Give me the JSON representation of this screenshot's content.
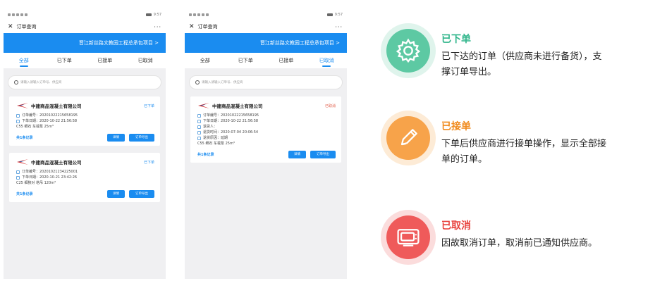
{
  "phones": [
    {
      "status_time": "9:57",
      "nav_title": "订单查询",
      "project": "晋江新丝路文教园工程总承包项目 >",
      "tabs": [
        {
          "label": "全部",
          "active": true
        },
        {
          "label": "已下单",
          "active": false
        },
        {
          "label": "已接单",
          "active": false
        },
        {
          "label": "已取消",
          "active": false
        }
      ],
      "search_placeholder": "请输入请输入订单号、供应商",
      "cards": [
        {
          "company": "中建商品混凝土有限公司",
          "status": "已下单",
          "order_no": "订单编号：20201022215658195",
          "order_date": "下单日期：2020-10-22 21:56:58",
          "spec": "C55 细石  车载泵   25m³",
          "total": "共1条记录",
          "btn_detail": "详情",
          "btn_export": "订单导出"
        },
        {
          "company": "中建商品混凝土有限公司",
          "status": "已下单",
          "order_no": "订单编号：20201021234225001",
          "order_date": "下单日期：2020-10-21 23:42:26",
          "spec": "C25 细狭对  塔吊   120m³",
          "total": "共1条记录",
          "btn_detail": "详情",
          "btn_export": "订单导出"
        }
      ]
    },
    {
      "status_time": "9:57",
      "nav_title": "订单查询",
      "project": "晋江新丝路文教园工程总承包项目 >",
      "tabs": [
        {
          "label": "全部",
          "active": false
        },
        {
          "label": "已下单",
          "active": false
        },
        {
          "label": "已接单",
          "active": false
        },
        {
          "label": "已取消",
          "active": true
        }
      ],
      "search_placeholder": "请输入请输入订单号、供应商",
      "cards": [
        {
          "company": "中建商品混凝土有限公司",
          "status": "已取消",
          "order_no": "订单编号：20201022215658195",
          "order_date": "下单日期：2020-10-22 21:56:58",
          "returner": "退货人：",
          "return_time": "退货时间：2020-07-04 20:06:54",
          "return_reason": "退货原因：延期",
          "spec": "C55 细石  车载泵   25m³",
          "total": "共1条记录",
          "btn_detail": "详情",
          "btn_export": "订单导出"
        }
      ]
    }
  ],
  "features": [
    {
      "title": "已下单",
      "desc_line1": "已下达的订单（供应商未进行备货），支",
      "desc_line2": "撑订单导出。",
      "icon": "gear-icon",
      "color": "#5dc9a3",
      "title_color": "#2fb58a"
    },
    {
      "title": "已接单",
      "desc_line1": "下单后供应商进行接单操作，显示全部接",
      "desc_line2": "单的订单。",
      "icon": "pencil-icon",
      "color": "#f7a34a",
      "title_color": "#f08a1c"
    },
    {
      "title": "已取消",
      "desc_line1": "因故取消订单，取消前已通知供应商。",
      "desc_line2": "",
      "icon": "tv-icon",
      "color": "#ef5a5a",
      "title_color": "#e8443f"
    }
  ]
}
